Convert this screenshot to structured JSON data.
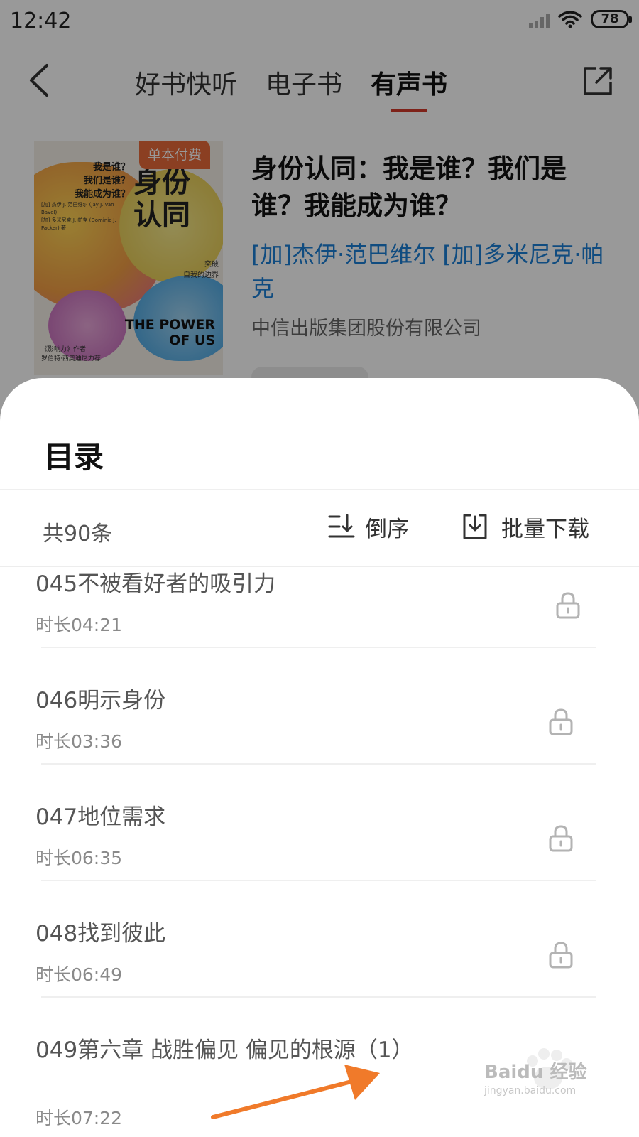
{
  "status_bar": {
    "time": "12:42",
    "battery": "78"
  },
  "nav": {
    "tabs": [
      {
        "label": "好书快听",
        "active": false
      },
      {
        "label": "电子书",
        "active": false
      },
      {
        "label": "有声书",
        "active": true
      }
    ],
    "icons": {
      "back": "back-arrow-icon",
      "share": "share-icon"
    }
  },
  "book": {
    "badge": "单本付费",
    "title": "身份认同：我是谁？我们是谁？我能成为谁？",
    "authors": "[加]杰伊·范巴维尔 [加]多米尼克·帕克",
    "publisher": "中信出版集团股份有限公司",
    "cover": {
      "questions": "我是谁？\n我们是谁？\n我能成为谁？",
      "title_cn": "身份\n认同",
      "subtitle": "突破\n自我的边界",
      "title_en": "THE POWER\nOF US",
      "author_line": "[加] 杰伊·J. 范巴维尔 (Jay J. Van Bavel)\n[加] 多米尼克·J. 帕克 (Dominic J. Packer) 著",
      "footer": "《影响力》作者\n罗伯特·西奥迪尼力荐"
    }
  },
  "sheet": {
    "title": "目录",
    "count_label": "共90条",
    "sort_label": "倒序",
    "download_label": "批量下载"
  },
  "episodes": [
    {
      "title": "045不被看好者的吸引力",
      "duration": "时长04:21",
      "locked": true
    },
    {
      "title": "046明示身份",
      "duration": "时长03:36",
      "locked": true
    },
    {
      "title": "047地位需求",
      "duration": "时长06:35",
      "locked": true
    },
    {
      "title": "048找到彼此",
      "duration": "时长06:49",
      "locked": true
    },
    {
      "title": "049第六章 战胜偏见 偏见的根源（1）",
      "duration": "时长07:22",
      "locked": true
    }
  ],
  "watermark": {
    "text": "Baidu 经验",
    "sub": "jingyan.baidu.com"
  },
  "colors": {
    "accent_red": "#d23a2a",
    "author_blue": "#1c7fd6",
    "badge_orange": "#e86a3a",
    "arrow_orange": "#f07a2a"
  }
}
